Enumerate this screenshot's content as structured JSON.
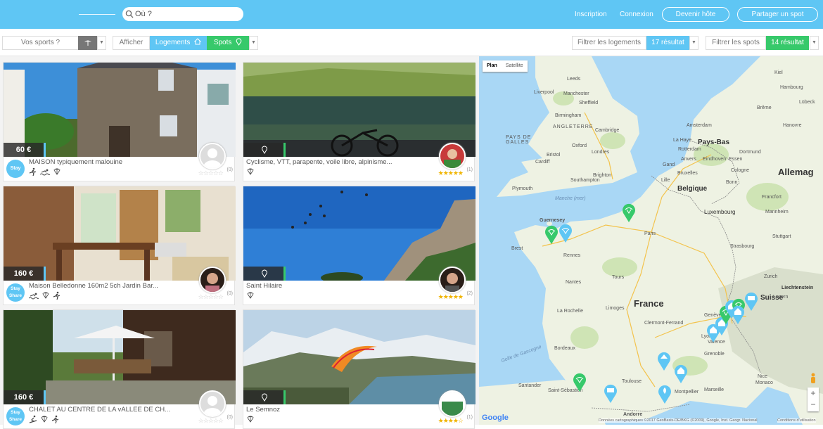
{
  "header": {
    "search_placeholder": "Où ?",
    "links": [
      "Inscription",
      "Connexion"
    ],
    "buttons": [
      "Devenir hôte",
      "Partager un spot"
    ]
  },
  "filters": {
    "sports_placeholder": "Vos sports ?",
    "show_label": "Afficher",
    "toggle_logements": "Logements",
    "toggle_spots": "Spots",
    "filter_logements": "Filtrer les logements",
    "logements_count": "17 résultat",
    "filter_spots": "Filtrer les spots",
    "spots_count": "14 résultat"
  },
  "colors": {
    "accent_blue": "#5fc6f4",
    "accent_green": "#37c96b",
    "star": "#f0b400"
  },
  "listings": [
    {
      "price": "60 €",
      "title": "MAISON typiquement malouine",
      "badge": "Stay",
      "count": "(0)",
      "rating": 0,
      "icons": [
        "runner-icon",
        "swimmer-icon",
        "paraglider-icon"
      ]
    },
    {
      "title": "Cyclisme, VTT, parapente, voile libre, alpinisme...",
      "count": "(1)",
      "rating": 5,
      "icons": [
        "paraglider-icon"
      ]
    },
    {
      "price": "160 €",
      "title": "Maison Belledonne 160m2 5ch Jardin Bar...",
      "badge": "Stay Share",
      "count": "(0)",
      "rating": 0,
      "icons": [
        "swimmer-icon",
        "paraglider-icon",
        "runner-icon"
      ]
    },
    {
      "title": "Saint Hilaire",
      "count": "(2)",
      "rating": 5,
      "icons": [
        "paraglider-icon"
      ]
    },
    {
      "price": "160 €",
      "title": "CHALET AU CENTRE DE LA vALLEE DE CH...",
      "badge": "Stay Share",
      "count": "(0)",
      "rating": 0,
      "icons": [
        "skier-icon",
        "paraglider-icon",
        "runner-icon"
      ]
    },
    {
      "title": "Le Semnoz",
      "count": "(1)",
      "rating": 4,
      "icons": [
        "paraglider-icon"
      ]
    }
  ],
  "map": {
    "type_buttons": [
      "Plan",
      "Satellite"
    ],
    "countries": [
      "France",
      "Allemag",
      "Belgique",
      "Pays-Bas",
      "Luxembourg",
      "ANGLETERRE",
      "PAYS DE GALLES",
      "Suisse"
    ],
    "cities": [
      "Leeds",
      "Liverpool",
      "Manchester",
      "Sheffield",
      "Birmingham",
      "Cambridge",
      "Oxford",
      "Londres",
      "Cardiff",
      "Bristol",
      "Southampton",
      "Brighton",
      "Plymouth",
      "Guernesey",
      "Brest",
      "Rennes",
      "Nantes",
      "Tours",
      "Paris",
      "Lille",
      "Bruxelles",
      "Anvers",
      "Gand",
      "Amsterdam",
      "La Haye",
      "Rotterdam",
      "Eindhoven",
      "Dortmund",
      "Essen",
      "Cologne",
      "Bonn",
      "Francfort",
      "Mannheim",
      "Stuttgart",
      "Strasbourg",
      "Zurich",
      "Hambourg",
      "Brême",
      "Hanovre",
      "Kiel",
      "Lübeck",
      "La Rochelle",
      "Limoges",
      "Clermont-Ferrand",
      "Lyon",
      "Genève",
      "Grenoble",
      "Bordeaux",
      "Toulouse",
      "Montpellier",
      "Marseille",
      "Nice",
      "Monaco",
      "Santander",
      "Andorre",
      "Saint-Sébastien",
      "Liechtenstein",
      "Luzern",
      "Valence"
    ],
    "sea_labels": [
      "Manche (mer)",
      "Golfe de Gascogne"
    ],
    "footer_text": "Données cartographiques ©2017 GeoBasis-DE/BKG (©2009), Google, Inst. Geogr. Nacional",
    "footer_terms": "Conditions d'utilisation",
    "google": "Google",
    "zoom_in": "+",
    "zoom_out": "−"
  }
}
